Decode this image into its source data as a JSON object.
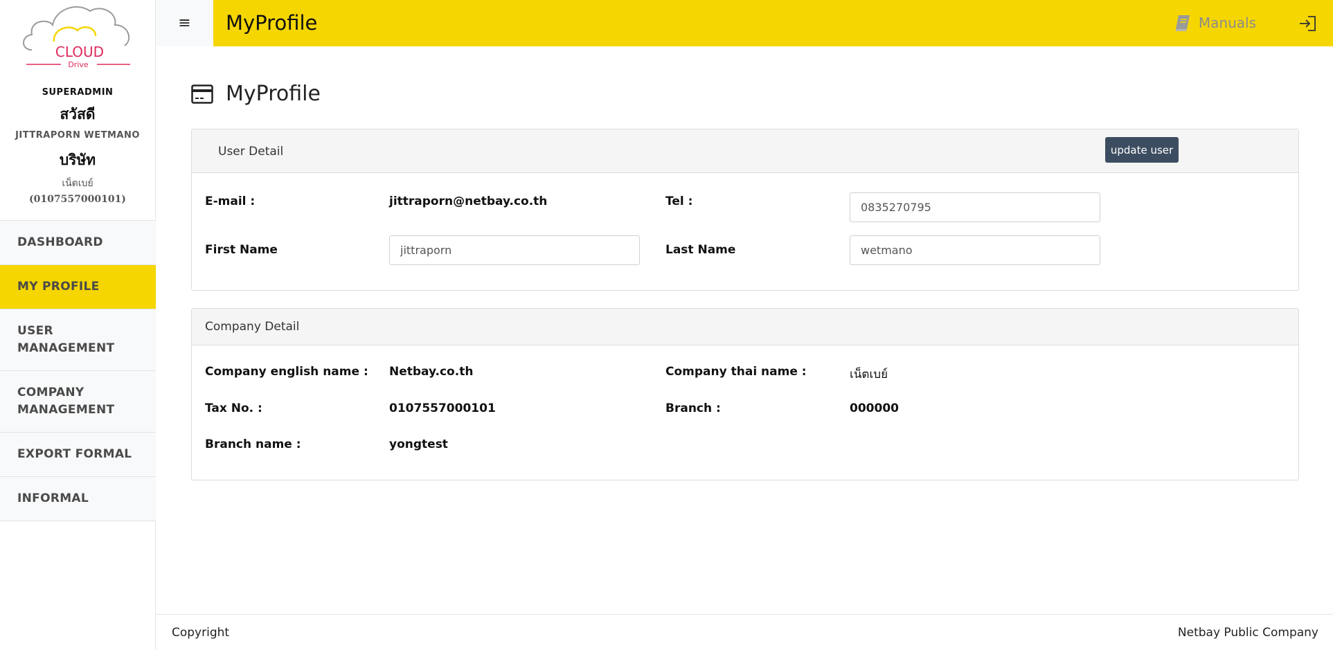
{
  "brand": {
    "logo_main": "CLOUD",
    "logo_sub": "Drive"
  },
  "user": {
    "role": "SUPERADMIN",
    "greeting": "สวัสดี",
    "name": "JITTRAPORN WETMANO",
    "company_label": "บริษัท",
    "company": "เน็ตเบย์",
    "tax_id": "(0107557000101)"
  },
  "nav": {
    "items": [
      {
        "label": "DASHBOARD"
      },
      {
        "label": "MY PROFILE",
        "active": true
      },
      {
        "label": "USER MANAGEMENT"
      },
      {
        "label": "COMPANY MANAGEMENT"
      },
      {
        "label": "EXPORT FORMAL"
      },
      {
        "label": "INFORMAL"
      }
    ]
  },
  "topbar": {
    "menu_glyph": "≡",
    "title": "MyProfile",
    "manuals_label": "Manuals"
  },
  "page": {
    "title": "MyProfile"
  },
  "user_detail": {
    "title": "User Detail",
    "update_button": "update user",
    "email_label": "E-mail :",
    "email_value": "jittraporn@netbay.co.th",
    "tel_label": "Tel :",
    "tel_value": "0835270795",
    "first_name_label": "First Name",
    "first_name_value": "jittraporn",
    "last_name_label": "Last Name",
    "last_name_value": "wetmano"
  },
  "company_detail": {
    "title": "Company Detail",
    "en_name_label": "Company english name :",
    "en_name_value": "Netbay.co.th",
    "th_name_label": "Company thai name :",
    "th_name_value": "เน็ตเบย์",
    "tax_label": "Tax No. :",
    "tax_value": "0107557000101",
    "branch_label": "Branch :",
    "branch_value": "000000",
    "branch_name_label": "Branch name :",
    "branch_name_value": "yongtest"
  },
  "footer": {
    "left": "Copyright",
    "right": "Netbay Public Company"
  },
  "colors": {
    "accent": "#f5d600",
    "button": "#3d4d61",
    "logo_red": "#e02a5c"
  }
}
